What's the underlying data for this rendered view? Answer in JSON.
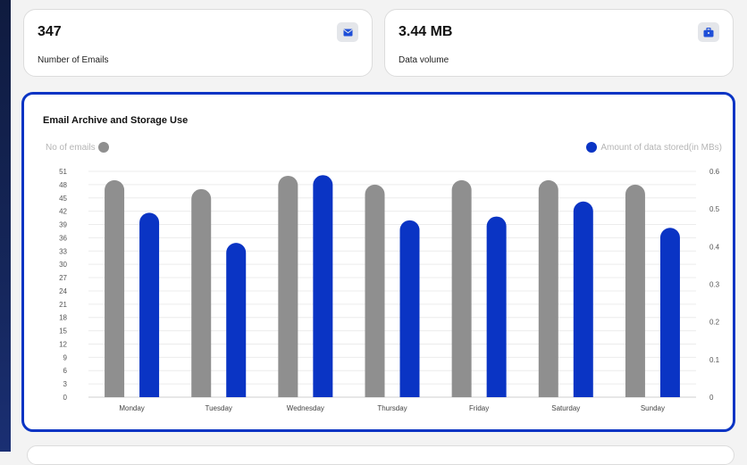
{
  "stats": [
    {
      "value": "347",
      "label": "Number of Emails",
      "icon": "envelope-icon"
    },
    {
      "value": "3.44 MB",
      "label": "Data volume",
      "icon": "briefcase-icon"
    }
  ],
  "colors": {
    "accent": "#0a34c4",
    "grey_series": "#8f8f8f",
    "blue_series": "#0a34c4"
  },
  "chart_data": {
    "type": "bar",
    "title": "Email Archive and Storage Use",
    "categories": [
      "Monday",
      "Tuesday",
      "Wednesday",
      "Thursday",
      "Friday",
      "Saturday",
      "Sunday"
    ],
    "series": [
      {
        "name": "No of emails",
        "axis": "left",
        "color": "#8f8f8f",
        "values": [
          49,
          47,
          50,
          48,
          49,
          49,
          48
        ]
      },
      {
        "name": "Amount of data stored(in MBs)",
        "axis": "right",
        "color": "#0a34c4",
        "values": [
          0.49,
          0.41,
          0.59,
          0.47,
          0.48,
          0.52,
          0.45
        ]
      }
    ],
    "y_left": {
      "ylim": [
        0,
        51
      ],
      "ticks": [
        "51",
        "48",
        "45",
        "42",
        "39",
        "36",
        "33",
        "30",
        "27",
        "24",
        "21",
        "18",
        "15",
        "12",
        "9",
        "6",
        "3",
        "0"
      ]
    },
    "y_right": {
      "ylim": [
        0,
        0.6
      ],
      "ticks": [
        "0.6",
        "0.5",
        "0.4",
        "0.3",
        "0.2",
        "0.1",
        "0"
      ]
    },
    "grid": true,
    "legend": {
      "left": "top-left",
      "right": "top-right"
    }
  }
}
